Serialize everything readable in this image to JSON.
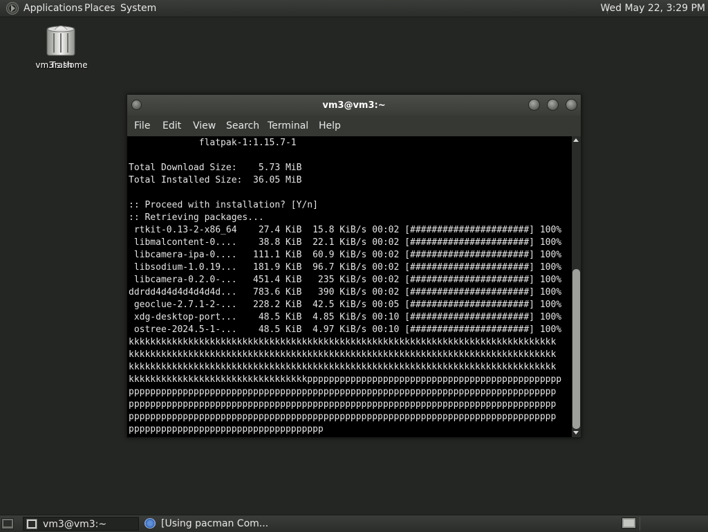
{
  "top_panel": {
    "applications": "Applications",
    "places": "Places",
    "system": "System",
    "clock": "Wed May 22,  3:29 PM"
  },
  "desktop": {
    "icon_labels": [
      "vm3's Home",
      "Trash"
    ]
  },
  "terminal": {
    "title": "vm3@vm3:~",
    "menu": [
      "File",
      "Edit",
      "View",
      "Search",
      "Terminal",
      "Help"
    ],
    "lines": [
      "             flatpak-1:1.15.7-1",
      "",
      "Total Download Size:    5.73 MiB",
      "Total Installed Size:  36.05 MiB",
      "",
      ":: Proceed with installation? [Y/n]",
      ":: Retrieving packages...",
      " rtkit-0.13-2-x86_64    27.4 KiB  15.8 KiB/s 00:02 [######################] 100%",
      " libmalcontent-0....    38.8 KiB  22.1 KiB/s 00:02 [######################] 100%",
      " libcamera-ipa-0....   111.1 KiB  60.9 KiB/s 00:02 [######################] 100%",
      " libsodium-1.0.19...   181.9 KiB  96.7 KiB/s 00:02 [######################] 100%",
      " libcamera-0.2.0-...   451.4 KiB   235 KiB/s 00:02 [######################] 100%",
      "ddrdd4d4d4d4d4d4d...   783.6 KiB   390 KiB/s 00:02 [######################] 100%",
      " geoclue-2.7.1-2-...   228.2 KiB  42.5 KiB/s 00:05 [######################] 100%",
      " xdg-desktop-port...    48.5 KiB  4.85 KiB/s 00:10 [######################] 100%",
      " ostree-2024.5-1-...    48.5 KiB  4.97 KiB/s 00:10 [######################] 100%",
      "kkkkkkkkkkkkkkkkkkkkkkkkkkkkkkkkkkkkkkkkkkkkkkkkkkkkkkkkkkkkkkkkkkkkkkkkkkkkkkk",
      "kkkkkkkkkkkkkkkkkkkkkkkkkkkkkkkkkkkkkkkkkkkkkkkkkkkkkkkkkkkkkkkkkkkkkkkkkkkkkkk",
      "kkkkkkkkkkkkkkkkkkkkkkkkkkkkkkkkkkkkkkkkkkkkkkkkkkkkkkkkkkkkkkkkkkkkkkkkkkkkkkk",
      "kkkkkkkkkkkkkkkkkkkkkkkkkkkkkkkkkppppppppppppppppppppppppppppppppppppppppppppppp",
      "ppppppppppppppppppppppppppppppppppppppppppppppppppppppppppppppppppppppppppppppp",
      "ppppppppppppppppppppppppppppppppppppppppppppppppppppppppppppppppppppppppppppppp",
      "ppppppppppppppppppppppppppppppppppppppppppppppppppppppppppppppppppppppppppppppp",
      "pppppppppppppppppppppppppppppppppppp"
    ]
  },
  "taskbar": {
    "tasks": [
      "vm3@vm3:~",
      "[Using pacman Com..."
    ]
  }
}
